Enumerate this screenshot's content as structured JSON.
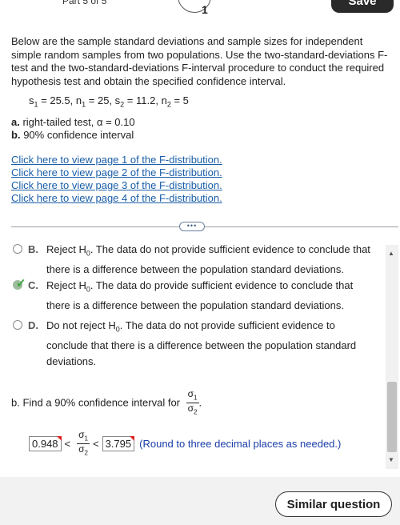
{
  "header": {
    "part_label": "Part 5 of 5",
    "step_number": "1",
    "save_label": "Save"
  },
  "question": {
    "intro": "Below are the sample standard deviations and sample sizes for independent simple random samples from two populations. Use the two-standard-deviations F-test and the two-standard-deviations F-interval procedure to conduct the required hypothesis test and obtain the specified confidence interval.",
    "s1": "25.5",
    "n1": "25",
    "s2": "11.2",
    "n2": "5",
    "part_a_label": "a.",
    "part_a_text": "right-tailed test, α = 0.10",
    "part_b_label": "b.",
    "part_b_text": "90% confidence interval",
    "links": [
      "Click here to view page 1 of the F-distribution.",
      "Click here to view page 2 of the F-distribution.",
      "Click here to view page 3 of the F-distribution.",
      "Click here to view page 4 of the F-distribution."
    ]
  },
  "splitter": {
    "handle": "•••"
  },
  "options": [
    {
      "letter": "B.",
      "text_pre": "Reject H",
      "text_post": ". The data do not provide sufficient evidence to conclude that there is a difference between the population standard deviations.",
      "selected": false
    },
    {
      "letter": "C.",
      "text_pre": "Reject H",
      "text_post": ". The data do provide sufficient evidence to conclude that there is a difference between the population standard deviations.",
      "selected": true
    },
    {
      "letter": "D.",
      "text_pre": "Do not reject H",
      "text_post": ". The data do not provide sufficient evidence to conclude that there is a difference between the population standard deviations.",
      "selected": false
    }
  ],
  "part_b": {
    "prompt": "b. Find a 90% confidence interval for",
    "lower": "0.948",
    "upper": "3.795",
    "note": "(Round to three decimal places as needed.)"
  },
  "footer": {
    "similar_label": "Similar question"
  },
  "colors": {
    "link": "#1a5ea8",
    "note": "#1a3ea8",
    "check": "#3da33d",
    "flag": "#dd2222"
  }
}
